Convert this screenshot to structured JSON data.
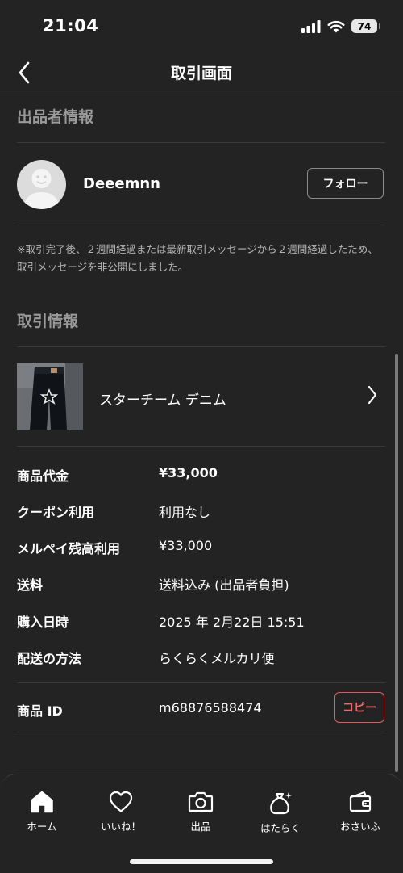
{
  "status_bar": {
    "time": "21:04",
    "battery": "74"
  },
  "nav": {
    "title": "取引画面"
  },
  "seller_section": {
    "title": "出品者情報",
    "seller_name": "Deeemnn",
    "follow_label": "フォロー",
    "notice": "※取引完了後、２週間経過または最新取引メッセージから２週間経過したため、取引メッセージを非公開にしました。"
  },
  "transaction_section": {
    "title": "取引情報",
    "product_name": "スターチーム デニム",
    "details": [
      {
        "label": "商品代金",
        "value": "¥33,000"
      },
      {
        "label": "クーポン利用",
        "value": "利用なし"
      },
      {
        "label": "メルペイ残高利用",
        "value": "¥33,000"
      },
      {
        "label": "送料",
        "value": "送料込み (出品者負担)"
      },
      {
        "label": "購入日時",
        "value": "2025 年 2月22日 15:51"
      },
      {
        "label": "配送の方法",
        "value": "らくらくメルカリ便"
      }
    ],
    "product_id": {
      "label": "商品 ID",
      "value": "m68876588474",
      "copy_label": "コピー"
    }
  },
  "tab_bar": {
    "items": [
      {
        "label": "ホーム",
        "icon": "home-icon"
      },
      {
        "label": "いいね！",
        "icon": "heart-icon"
      },
      {
        "label": "出品",
        "icon": "camera-icon"
      },
      {
        "label": "はたらく",
        "icon": "money-bag-icon"
      },
      {
        "label": "おさいふ",
        "icon": "wallet-icon"
      }
    ]
  },
  "colors": {
    "background": "#232323",
    "accent_red": "#f06767",
    "muted_text": "#9a9a9a"
  }
}
